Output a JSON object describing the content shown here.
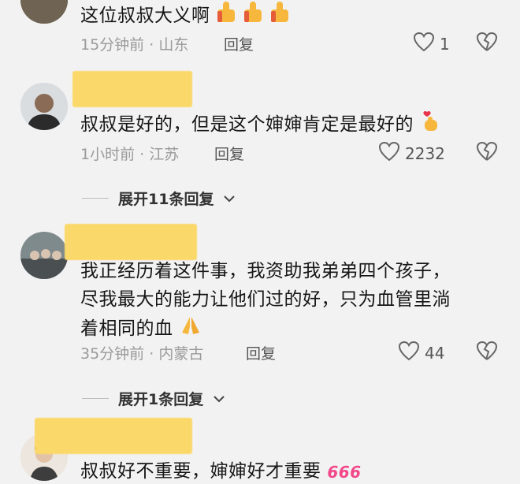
{
  "comments": [
    {
      "text": "这位叔叔大义啊",
      "time": "15分钟前",
      "location": "山东",
      "reply_label": "回复",
      "likes": "1"
    },
    {
      "text": "叔叔是好的，但是这个婶婶肯定是最好的",
      "time": "1小时前",
      "location": "江苏",
      "reply_label": "回复",
      "likes": "2232",
      "expand_label": "展开11条回复"
    },
    {
      "text_line1": "我正经历着这件事，我资助我弟弟四个孩子，",
      "text_line2": "尽我最大的能力让他们过的好，只为血管里淌",
      "text_line3": "着相同的血",
      "time": "35分钟前",
      "location": "内蒙古",
      "reply_label": "回复",
      "likes": "44",
      "expand_label": "展开1条回复"
    },
    {
      "text": "叔叔好不重要，婶婶好才重要"
    }
  ],
  "dot": "·",
  "icons": {
    "like": "heart-outline-icon",
    "dislike": "broken-heart-icon",
    "thumbs_up": "thumbs-up-emoji",
    "finger_heart": "finger-heart-emoji",
    "pray": "folded-hands-emoji",
    "number_666": "666-emoji",
    "chevron": "chevron-down-icon"
  },
  "emoji_666_text": "666"
}
